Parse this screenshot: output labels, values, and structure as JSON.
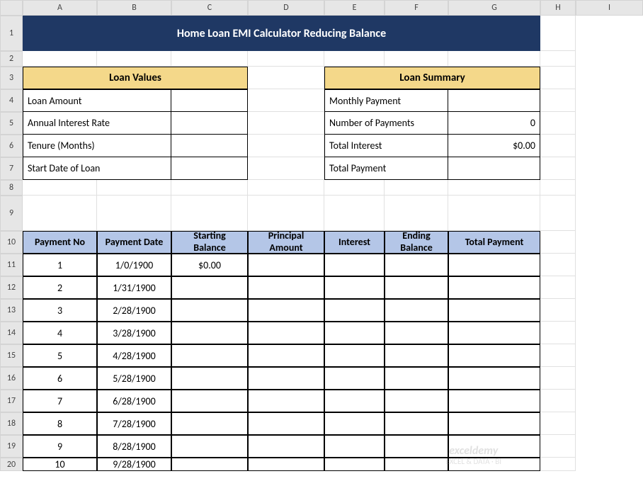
{
  "columns": [
    "A",
    "B",
    "C",
    "D",
    "E",
    "F",
    "G",
    "H",
    "I"
  ],
  "rows": [
    "1",
    "2",
    "3",
    "4",
    "5",
    "6",
    "7",
    "8",
    "9",
    "10",
    "11",
    "12",
    "13",
    "14",
    "15",
    "16",
    "17",
    "18",
    "19",
    "20"
  ],
  "title": "Home Loan EMI Calculator Reducing Balance",
  "loan_values": {
    "header": "Loan Values",
    "rows": [
      {
        "label": "Loan Amount",
        "value": ""
      },
      {
        "label": "Annual Interest Rate",
        "value": ""
      },
      {
        "label": "Tenure (Months)",
        "value": ""
      },
      {
        "label": "Start Date of Loan",
        "value": ""
      }
    ]
  },
  "loan_summary": {
    "header": "Loan Summary",
    "rows": [
      {
        "label": "Monthly Payment",
        "value": ""
      },
      {
        "label": "Number of Payments",
        "value": "0"
      },
      {
        "label": "Total Interest",
        "value": "$0.00"
      },
      {
        "label": "Total Payment",
        "value": ""
      }
    ]
  },
  "schedule": {
    "headers": [
      "Payment No",
      "Payment Date",
      "Starting Balance",
      "Principal Amount",
      "Interest",
      "Ending Balance",
      "Total Payment"
    ],
    "rows": [
      {
        "no": "1",
        "date": "1/0/1900",
        "start": "$0.00",
        "principal": "",
        "interest": "",
        "ending": "",
        "total": ""
      },
      {
        "no": "2",
        "date": "1/31/1900",
        "start": "",
        "principal": "",
        "interest": "",
        "ending": "",
        "total": ""
      },
      {
        "no": "3",
        "date": "2/28/1900",
        "start": "",
        "principal": "",
        "interest": "",
        "ending": "",
        "total": ""
      },
      {
        "no": "4",
        "date": "3/28/1900",
        "start": "",
        "principal": "",
        "interest": "",
        "ending": "",
        "total": ""
      },
      {
        "no": "5",
        "date": "4/28/1900",
        "start": "",
        "principal": "",
        "interest": "",
        "ending": "",
        "total": ""
      },
      {
        "no": "6",
        "date": "5/28/1900",
        "start": "",
        "principal": "",
        "interest": "",
        "ending": "",
        "total": ""
      },
      {
        "no": "7",
        "date": "6/28/1900",
        "start": "",
        "principal": "",
        "interest": "",
        "ending": "",
        "total": ""
      },
      {
        "no": "8",
        "date": "7/28/1900",
        "start": "",
        "principal": "",
        "interest": "",
        "ending": "",
        "total": ""
      },
      {
        "no": "9",
        "date": "8/28/1900",
        "start": "",
        "principal": "",
        "interest": "",
        "ending": "",
        "total": ""
      },
      {
        "no": "10",
        "date": "9/28/1900",
        "start": "",
        "principal": "",
        "interest": "",
        "ending": "",
        "total": ""
      }
    ]
  },
  "watermark": {
    "line1": "exceldemy",
    "line2": "EXCEL & DATA · BI"
  }
}
